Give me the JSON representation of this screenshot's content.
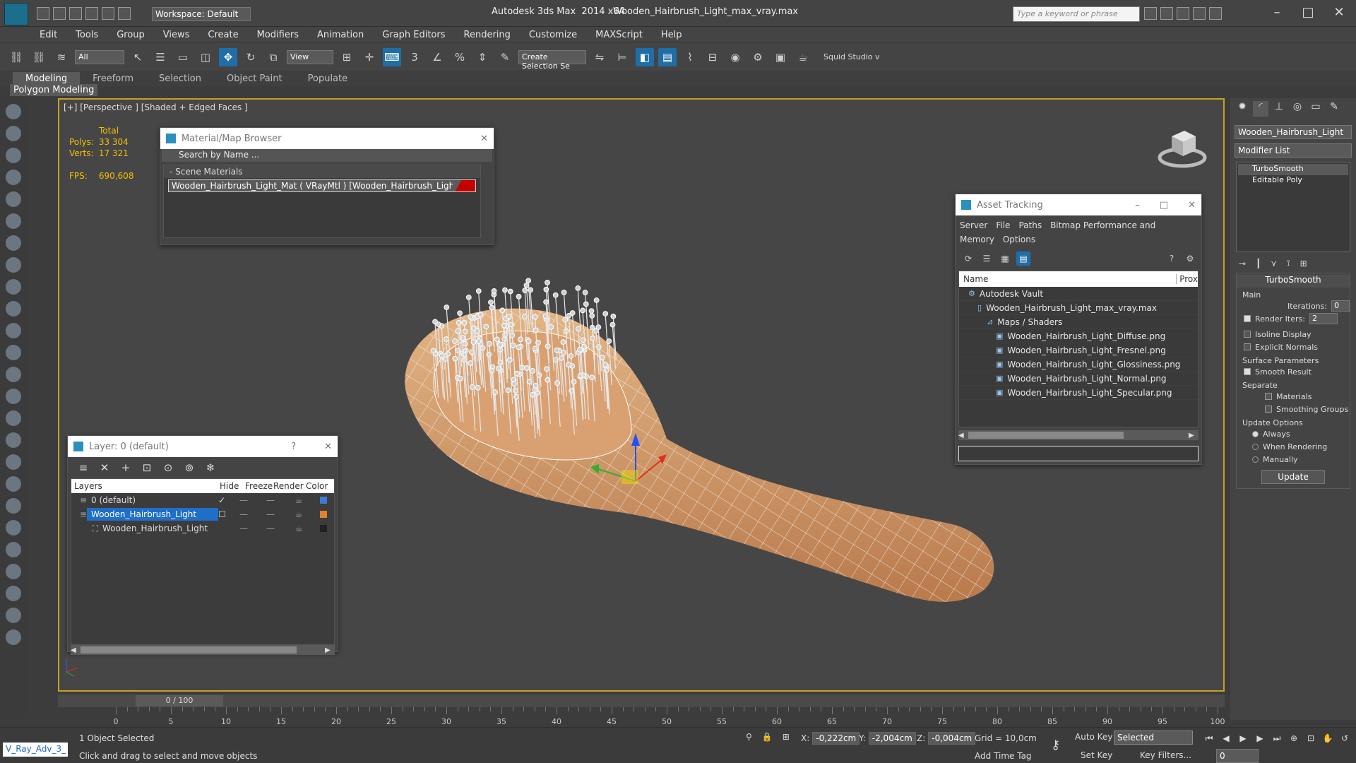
{
  "titlebar": {
    "workspace_label": "Workspace: Default",
    "app_title": "Autodesk 3ds Max  2014 x64",
    "file_title": "Wooden_Hairbrush_Light_max_vray.max",
    "search_placeholder": "Type a keyword or phrase",
    "minimize": "–",
    "maximize": "□",
    "close": "✕"
  },
  "menubar": {
    "items": [
      "Edit",
      "Tools",
      "Group",
      "Views",
      "Create",
      "Modifiers",
      "Animation",
      "Graph Editors",
      "Rendering",
      "Customize",
      "MAXScript",
      "Help"
    ]
  },
  "toolbar": {
    "filter_select": "All",
    "view_select": "View",
    "selection_set": "Create Selection Se",
    "squid_label": "Squid Studio v"
  },
  "ribbon": {
    "tabs": [
      "Modeling",
      "Freeform",
      "Selection",
      "Object Paint",
      "Populate"
    ],
    "active_tab": "Modeling",
    "sub_label": "Polygon Modeling"
  },
  "viewport": {
    "label": "[+] [Perspective ] [Shaded + Edged Faces ]",
    "stats_header": "Total",
    "polys_label": "Polys:",
    "polys_value": "33 304",
    "verts_label": "Verts:",
    "verts_value": "17 321",
    "fps_label": "FPS:",
    "fps_value": "690,608"
  },
  "material_browser": {
    "title": "Material/Map Browser",
    "search_placeholder": "Search by Name ...",
    "group": "- Scene Materials",
    "item": "Wooden_Hairbrush_Light_Mat ( VRayMtl ) [Wooden_Hairbrush_Light]"
  },
  "layer_panel": {
    "title": "Layer: 0 (default)",
    "help": "?",
    "columns": [
      "Layers",
      "Hide",
      "Freeze",
      "Render",
      "Color"
    ],
    "rows": [
      {
        "name": "0 (default)",
        "color": "#3a7bd5"
      },
      {
        "name": "Wooden_Hairbrush_Light",
        "color": "#e08030"
      },
      {
        "name": "Wooden_Hairbrush_Light",
        "color": "#222222"
      }
    ]
  },
  "asset_tracking": {
    "title": "Asset Tracking",
    "menu": [
      "Server",
      "File",
      "Paths",
      "Bitmap Performance and Memory",
      "Options"
    ],
    "col_name": "Name",
    "col_prox": "Prox",
    "rows": [
      {
        "label": "Autodesk Vault",
        "indent": 1
      },
      {
        "label": "Wooden_Hairbrush_Light_max_vray.max",
        "indent": 2
      },
      {
        "label": "Maps / Shaders",
        "indent": 3
      },
      {
        "label": "Wooden_Hairbrush_Light_Diffuse.png",
        "indent": 4
      },
      {
        "label": "Wooden_Hairbrush_Light_Fresnel.png",
        "indent": 4
      },
      {
        "label": "Wooden_Hairbrush_Light_Glossiness.png",
        "indent": 4
      },
      {
        "label": "Wooden_Hairbrush_Light_Normal.png",
        "indent": 4
      },
      {
        "label": "Wooden_Hairbrush_Light_Specular.png",
        "indent": 4
      }
    ]
  },
  "command_panel": {
    "object_name": "Wooden_Hairbrush_Light",
    "modifier_list": "Modifier List",
    "stack": [
      "TurboSmooth",
      "Editable Poly"
    ],
    "rollout_title": "TurboSmooth",
    "main_label": "Main",
    "iterations_label": "Iterations:",
    "iterations_value": "0",
    "render_iters_label": "Render Iters:",
    "render_iters_value": "2",
    "isoline": "Isoline Display",
    "explicit": "Explicit Normals",
    "surface_params": "Surface Parameters",
    "smooth_result": "Smooth Result",
    "separate": "Separate",
    "materials": "Materials",
    "smoothing_groups": "Smoothing Groups",
    "update_options": "Update Options",
    "always": "Always",
    "when_rendering": "When Rendering",
    "manually": "Manually",
    "update_button": "Update"
  },
  "timeline": {
    "slider": "0 / 100",
    "ticks": [
      "0",
      "5",
      "10",
      "15",
      "20",
      "25",
      "30",
      "35",
      "40",
      "45",
      "50",
      "55",
      "60",
      "65",
      "70",
      "75",
      "80",
      "85",
      "90",
      "95",
      "100"
    ]
  },
  "status": {
    "maxscript_box": "V_Ray_Adv_3_",
    "selection": "1 Object Selected",
    "hint": "Click and drag to select and move objects",
    "x_label": "X:",
    "x_value": "-0,222cm",
    "y_label": "Y:",
    "y_value": "-2,004cm",
    "z_label": "Z:",
    "z_value": "-0,004cm",
    "grid": "Grid = 10,0cm",
    "add_time_tag": "Add Time Tag",
    "auto_key": "Auto Key",
    "selected_combo": "Selected",
    "set_key": "Set Key",
    "key_filters": "Key Filters...",
    "frame_value": "0"
  }
}
